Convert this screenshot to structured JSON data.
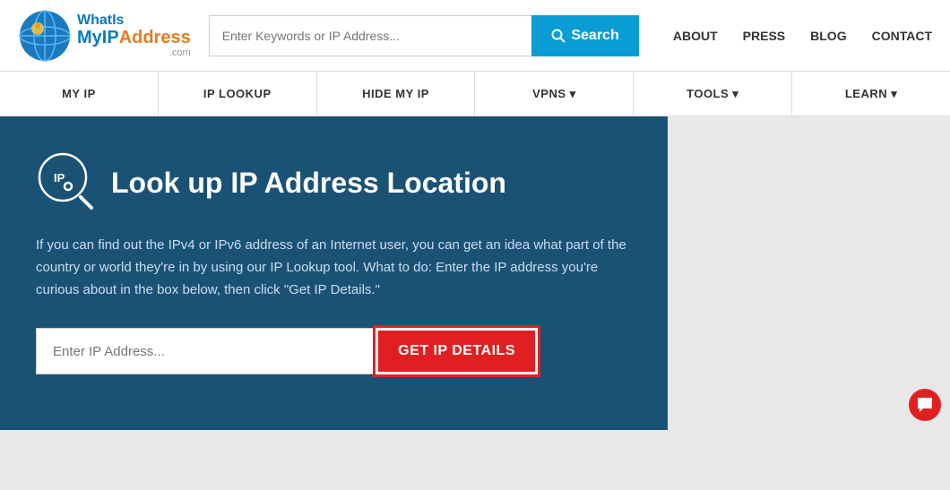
{
  "header": {
    "logo": {
      "what": "WhatIs",
      "myip": "MyIP",
      "address": "Address",
      "com": ".com"
    },
    "search": {
      "placeholder": "Enter Keywords or IP Address...",
      "button_label": "Search"
    },
    "nav": {
      "about": "ABOUT",
      "press": "PRESS",
      "blog": "BLOG",
      "contact": "CONTACT"
    }
  },
  "navbar": {
    "items": [
      {
        "label": "MY IP"
      },
      {
        "label": "IP LOOKUP"
      },
      {
        "label": "HIDE MY IP"
      },
      {
        "label": "VPNS ▾"
      },
      {
        "label": "TOOLS ▾"
      },
      {
        "label": "LEARN ▾"
      }
    ]
  },
  "main": {
    "title": "Look up IP Address Location",
    "description": "If you can find out the IPv4 or IPv6 address of an Internet user, you can get an idea what part of the country or world they're in by using our IP Lookup tool. What to do: Enter the IP address you're curious about in the box below, then click \"Get IP Details.\"",
    "ip_input_placeholder": "Enter IP Address...",
    "get_details_label": "GET IP DETAILS"
  },
  "colors": {
    "accent_blue": "#0a9dd4",
    "panel_bg": "#1a5276",
    "red": "#e02020"
  }
}
